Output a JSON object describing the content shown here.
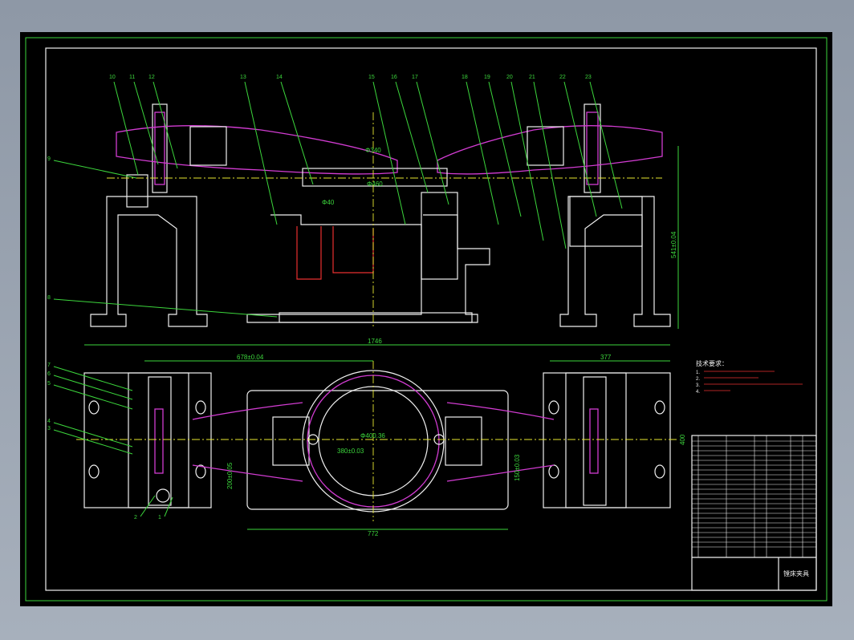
{
  "colors": {
    "background": "#000000",
    "outline": "#f0f0f0",
    "dimension": "#3cd63c",
    "profile": "#d23cd2",
    "hidden": "#e83030",
    "centerline": "#e8e830"
  },
  "balloons_top": [
    "10",
    "11",
    "12",
    "13",
    "14",
    "15",
    "16",
    "17",
    "18",
    "19",
    "20",
    "21",
    "22",
    "23"
  ],
  "balloons_left_top": [
    "9",
    "8"
  ],
  "balloons_left_plan": [
    "7",
    "6",
    "5",
    "4",
    "3"
  ],
  "balloons_bottom_plan": [
    "2",
    "1"
  ],
  "dims": {
    "phi_340": "Φ340",
    "phi_460": "Φ460",
    "phi_40": "Φ40",
    "height_541": "541±0.04",
    "total_1746": "1746",
    "d_678": "678±0.04",
    "d_377": "377",
    "phi_400": "Φ400.36",
    "d_380": "380±0.03",
    "d_200": "200±0.05",
    "d_150": "150±0.03",
    "d_772": "772",
    "d_400": "400"
  },
  "notes": {
    "title": "技术要求：",
    "lines": [
      "1.",
      "2.",
      "3.",
      "4."
    ]
  },
  "title_block": {
    "drawing_name": "镗床夹具"
  }
}
